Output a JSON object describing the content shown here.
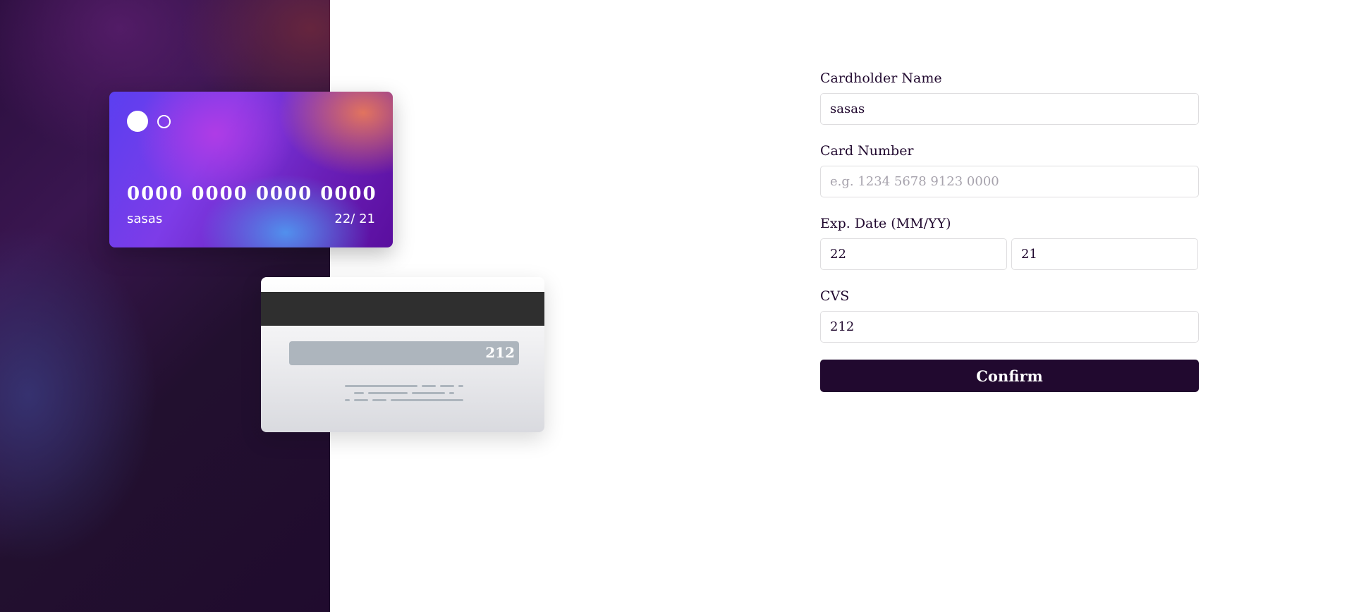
{
  "card_front": {
    "number": "0000 0000 0000 0000",
    "name": "sasas",
    "exp": "22/ 21"
  },
  "card_back": {
    "cvc": "212"
  },
  "form": {
    "cardholder": {
      "label": "Cardholder Name",
      "value": "sasas",
      "placeholder": ""
    },
    "card_number": {
      "label": "Card Number",
      "value": "",
      "placeholder": "e.g. 1234 5678 9123 0000"
    },
    "exp_date": {
      "label": "Exp. Date (MM/YY)",
      "month": "22",
      "year": "21"
    },
    "cvs": {
      "label": "CVS",
      "value": "212"
    },
    "confirm_label": "Confirm"
  },
  "colors": {
    "dark_purple": "#21092f",
    "border": "#dedddf",
    "placeholder": "#a7a3ad"
  }
}
